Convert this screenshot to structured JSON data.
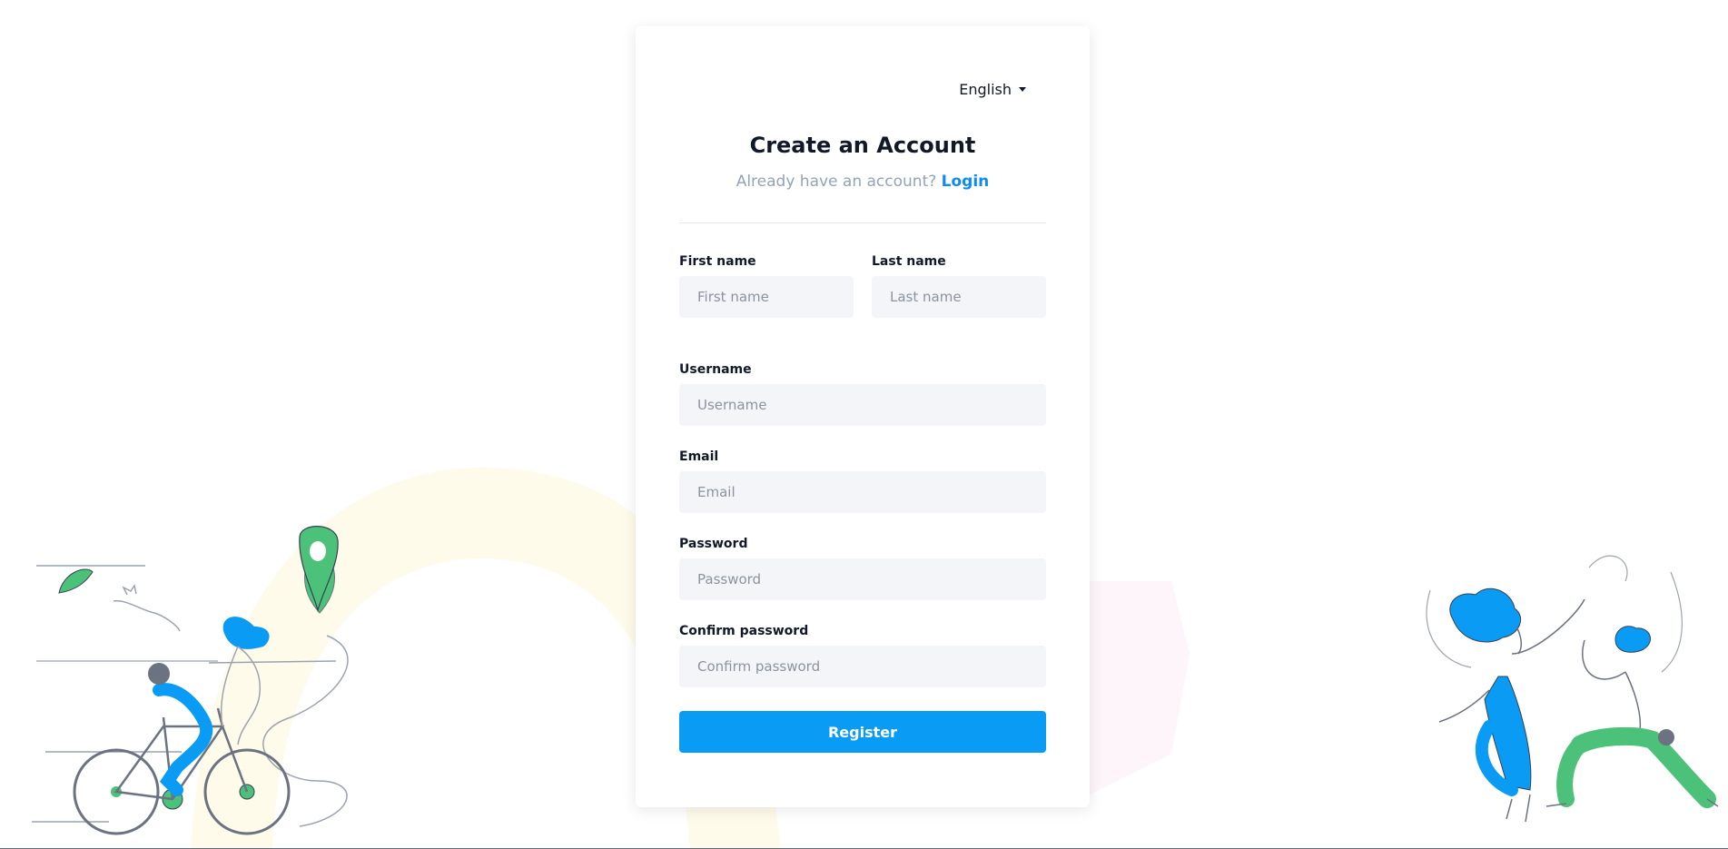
{
  "header": {
    "language": "English"
  },
  "form": {
    "title": "Create an Account",
    "subtitle_text": "Already have an account?",
    "login_link": "Login",
    "fields": {
      "first_name": {
        "label": "First name",
        "placeholder": "First name",
        "value": ""
      },
      "last_name": {
        "label": "Last name",
        "placeholder": "Last name",
        "value": ""
      },
      "username": {
        "label": "Username",
        "placeholder": "Username",
        "value": ""
      },
      "email": {
        "label": "Email",
        "placeholder": "Email",
        "value": ""
      },
      "password": {
        "label": "Password",
        "placeholder": "Password",
        "value": ""
      },
      "confirm_password": {
        "label": "Confirm password",
        "placeholder": "Confirm password",
        "value": ""
      }
    },
    "submit_label": "Register"
  },
  "colors": {
    "accent": "#0a9bf5",
    "link": "#0d8df0",
    "input_bg": "#f3f5f8",
    "illustration_green": "#4cc17a",
    "illustration_blue": "#0a9bf5"
  }
}
